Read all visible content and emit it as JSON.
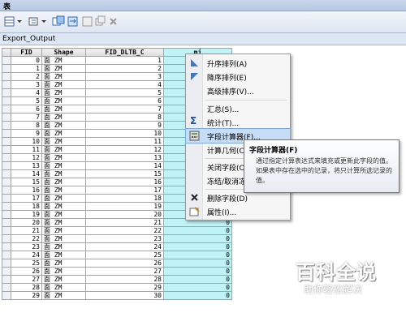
{
  "window": {
    "title": "表"
  },
  "tab": {
    "label": "Export_Output"
  },
  "table": {
    "columns": [
      "FID",
      "Shape",
      "FID_DLTB_C",
      "mj"
    ],
    "rows": [
      [
        "0",
        "面 ZM",
        "1",
        ""
      ],
      [
        "1",
        "面 ZM",
        "2",
        ""
      ],
      [
        "2",
        "面 ZM",
        "3",
        ""
      ],
      [
        "3",
        "面 ZM",
        "4",
        ""
      ],
      [
        "4",
        "面 ZM",
        "5",
        ""
      ],
      [
        "5",
        "面 ZM",
        "6",
        ""
      ],
      [
        "6",
        "面 ZM",
        "7",
        ""
      ],
      [
        "7",
        "面 ZM",
        "8",
        ""
      ],
      [
        "8",
        "面 ZM",
        "9",
        ""
      ],
      [
        "9",
        "面 ZM",
        "10",
        ""
      ],
      [
        "10",
        "面 ZM",
        "11",
        ""
      ],
      [
        "11",
        "面 ZM",
        "12",
        ""
      ],
      [
        "12",
        "面 ZM",
        "13",
        ""
      ],
      [
        "13",
        "面 ZM",
        "14",
        ""
      ],
      [
        "14",
        "面 ZM",
        "15",
        ""
      ],
      [
        "15",
        "面 ZM",
        "16",
        ""
      ],
      [
        "16",
        "面 ZM",
        "17",
        ""
      ],
      [
        "17",
        "面 ZM",
        "18",
        ""
      ],
      [
        "18",
        "面 ZM",
        "19",
        "0"
      ],
      [
        "19",
        "面 ZM",
        "20",
        "0"
      ],
      [
        "20",
        "面 ZM",
        "21",
        "0"
      ],
      [
        "21",
        "面 ZM",
        "22",
        "0"
      ],
      [
        "22",
        "面 ZM",
        "23",
        "0"
      ],
      [
        "23",
        "面 ZM",
        "24",
        "0"
      ],
      [
        "24",
        "面 ZM",
        "25",
        "0"
      ],
      [
        "25",
        "面 ZM",
        "26",
        "0"
      ],
      [
        "26",
        "面 ZM",
        "27",
        "0"
      ],
      [
        "27",
        "面 ZM",
        "28",
        "0"
      ],
      [
        "28",
        "面 ZM",
        "29",
        "0"
      ],
      [
        "29",
        "面 ZM",
        "30",
        "0"
      ]
    ]
  },
  "context_menu": {
    "items": [
      {
        "label": "升序排列(A)",
        "icon": "sort-ascending-icon"
      },
      {
        "label": "降序排列(E)",
        "icon": "sort-descending-icon"
      },
      {
        "label": "高级排序(V)...",
        "icon": ""
      },
      {
        "label": "汇总(S)...",
        "icon": ""
      },
      {
        "label": "统计(T)...",
        "icon": "sigma-icon"
      },
      {
        "label": "字段计算器(F)...",
        "icon": "calculator-icon"
      },
      {
        "label": "计算几何(C)...",
        "icon": ""
      },
      {
        "label": "关闭字段(O)",
        "icon": ""
      },
      {
        "label": "冻结/取消冻结列(Z)",
        "icon": ""
      },
      {
        "label": "删除字段(D)",
        "icon": "delete-x-icon"
      },
      {
        "label": "属性(I)...",
        "icon": "properties-icon"
      }
    ]
  },
  "tooltip": {
    "title": "字段计算器(F)",
    "body": "通过指定计算表达式来填充或更新此字段的值。如果表中存在选中的记录，将只计算所选记录的值。"
  },
  "watermark": {
    "text": "百科全说",
    "sub": "助你轻松解决"
  },
  "colors": {
    "field_highlight": "#bff3f6",
    "menu_highlight": "#c7ddf6"
  }
}
